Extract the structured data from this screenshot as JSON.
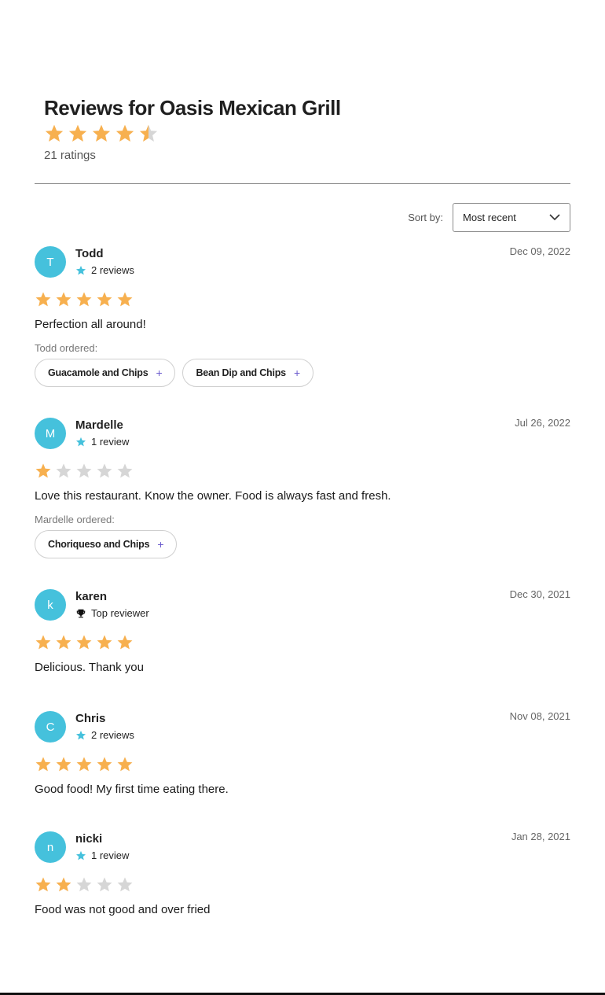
{
  "header": {
    "title": "Reviews for Oasis Mexican Grill",
    "rating": 4.5,
    "ratings_count": "21 ratings"
  },
  "sort": {
    "label": "Sort by:",
    "value": "Most recent"
  },
  "colors": {
    "star_filled": "#f7b04f",
    "star_empty": "#d6d6d6",
    "avatar_bg": "#45c1dc",
    "badge_star": "#45c1dc",
    "chip_plus": "#6a5acd"
  },
  "reviews": [
    {
      "initial": "T",
      "name": "Todd",
      "badge_icon": "star-icon",
      "badge_text": "2 reviews",
      "date": "Dec 09, 2022",
      "rating": 5,
      "text": "Perfection all around!",
      "ordered_label": "Todd ordered:",
      "items": [
        "Guacamole and Chips",
        "Bean Dip and Chips"
      ]
    },
    {
      "initial": "M",
      "name": "Mardelle",
      "badge_icon": "star-icon",
      "badge_text": "1 review",
      "date": "Jul 26, 2022",
      "rating": 1,
      "text": "Love this restaurant. Know the owner. Food is always fast and fresh.",
      "ordered_label": "Mardelle ordered:",
      "items": [
        "Choriqueso and Chips"
      ]
    },
    {
      "initial": "k",
      "name": "karen",
      "badge_icon": "trophy-icon",
      "badge_text": "Top reviewer",
      "date": "Dec 30, 2021",
      "rating": 5,
      "text": "Delicious. Thank you",
      "ordered_label": "",
      "items": []
    },
    {
      "initial": "C",
      "name": "Chris",
      "badge_icon": "star-icon",
      "badge_text": "2 reviews",
      "date": "Nov 08, 2021",
      "rating": 5,
      "text": "Good food! My first time eating there.",
      "ordered_label": "",
      "items": []
    },
    {
      "initial": "n",
      "name": "nicki",
      "badge_icon": "star-icon",
      "badge_text": "1 review",
      "date": "Jan 28, 2021",
      "rating": 2,
      "text": "Food was not good and over fried",
      "ordered_label": "",
      "items": []
    }
  ]
}
